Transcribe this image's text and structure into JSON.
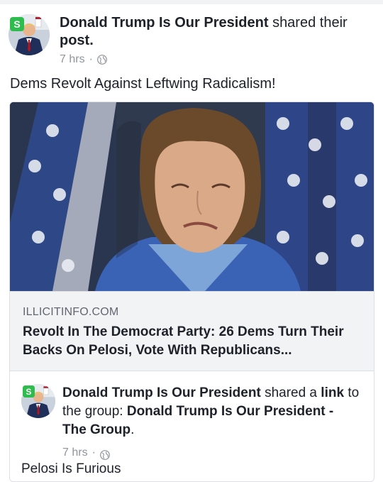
{
  "post": {
    "author": "Donald Trump Is Our President",
    "action": "shared their",
    "object": "post.",
    "time": "7 hrs",
    "separator": "·",
    "status": "Dems Revolt Against Leftwing Radicalism!"
  },
  "link_card": {
    "domain": "ILLICITINFO.COM",
    "headline": "Revolt In The Democrat Party: 26 Dems Turn Their Backs On Pelosi, Vote With Republicans..."
  },
  "shared_post": {
    "author": "Donald Trump Is Our President",
    "action": "shared a",
    "link_word": "link",
    "to_group": "to the group:",
    "group_name": "Donald Trump Is Our President - The Group",
    "period": ".",
    "time": "7 hrs",
    "separator": "·",
    "status": "Pelosi Is Furious"
  },
  "icons": {
    "globe": "globe-icon",
    "avatar_badge": "dollar-badge-icon"
  },
  "colors": {
    "text": "#1d2129",
    "meta": "#90949c",
    "card_bg": "#f2f3f5"
  }
}
